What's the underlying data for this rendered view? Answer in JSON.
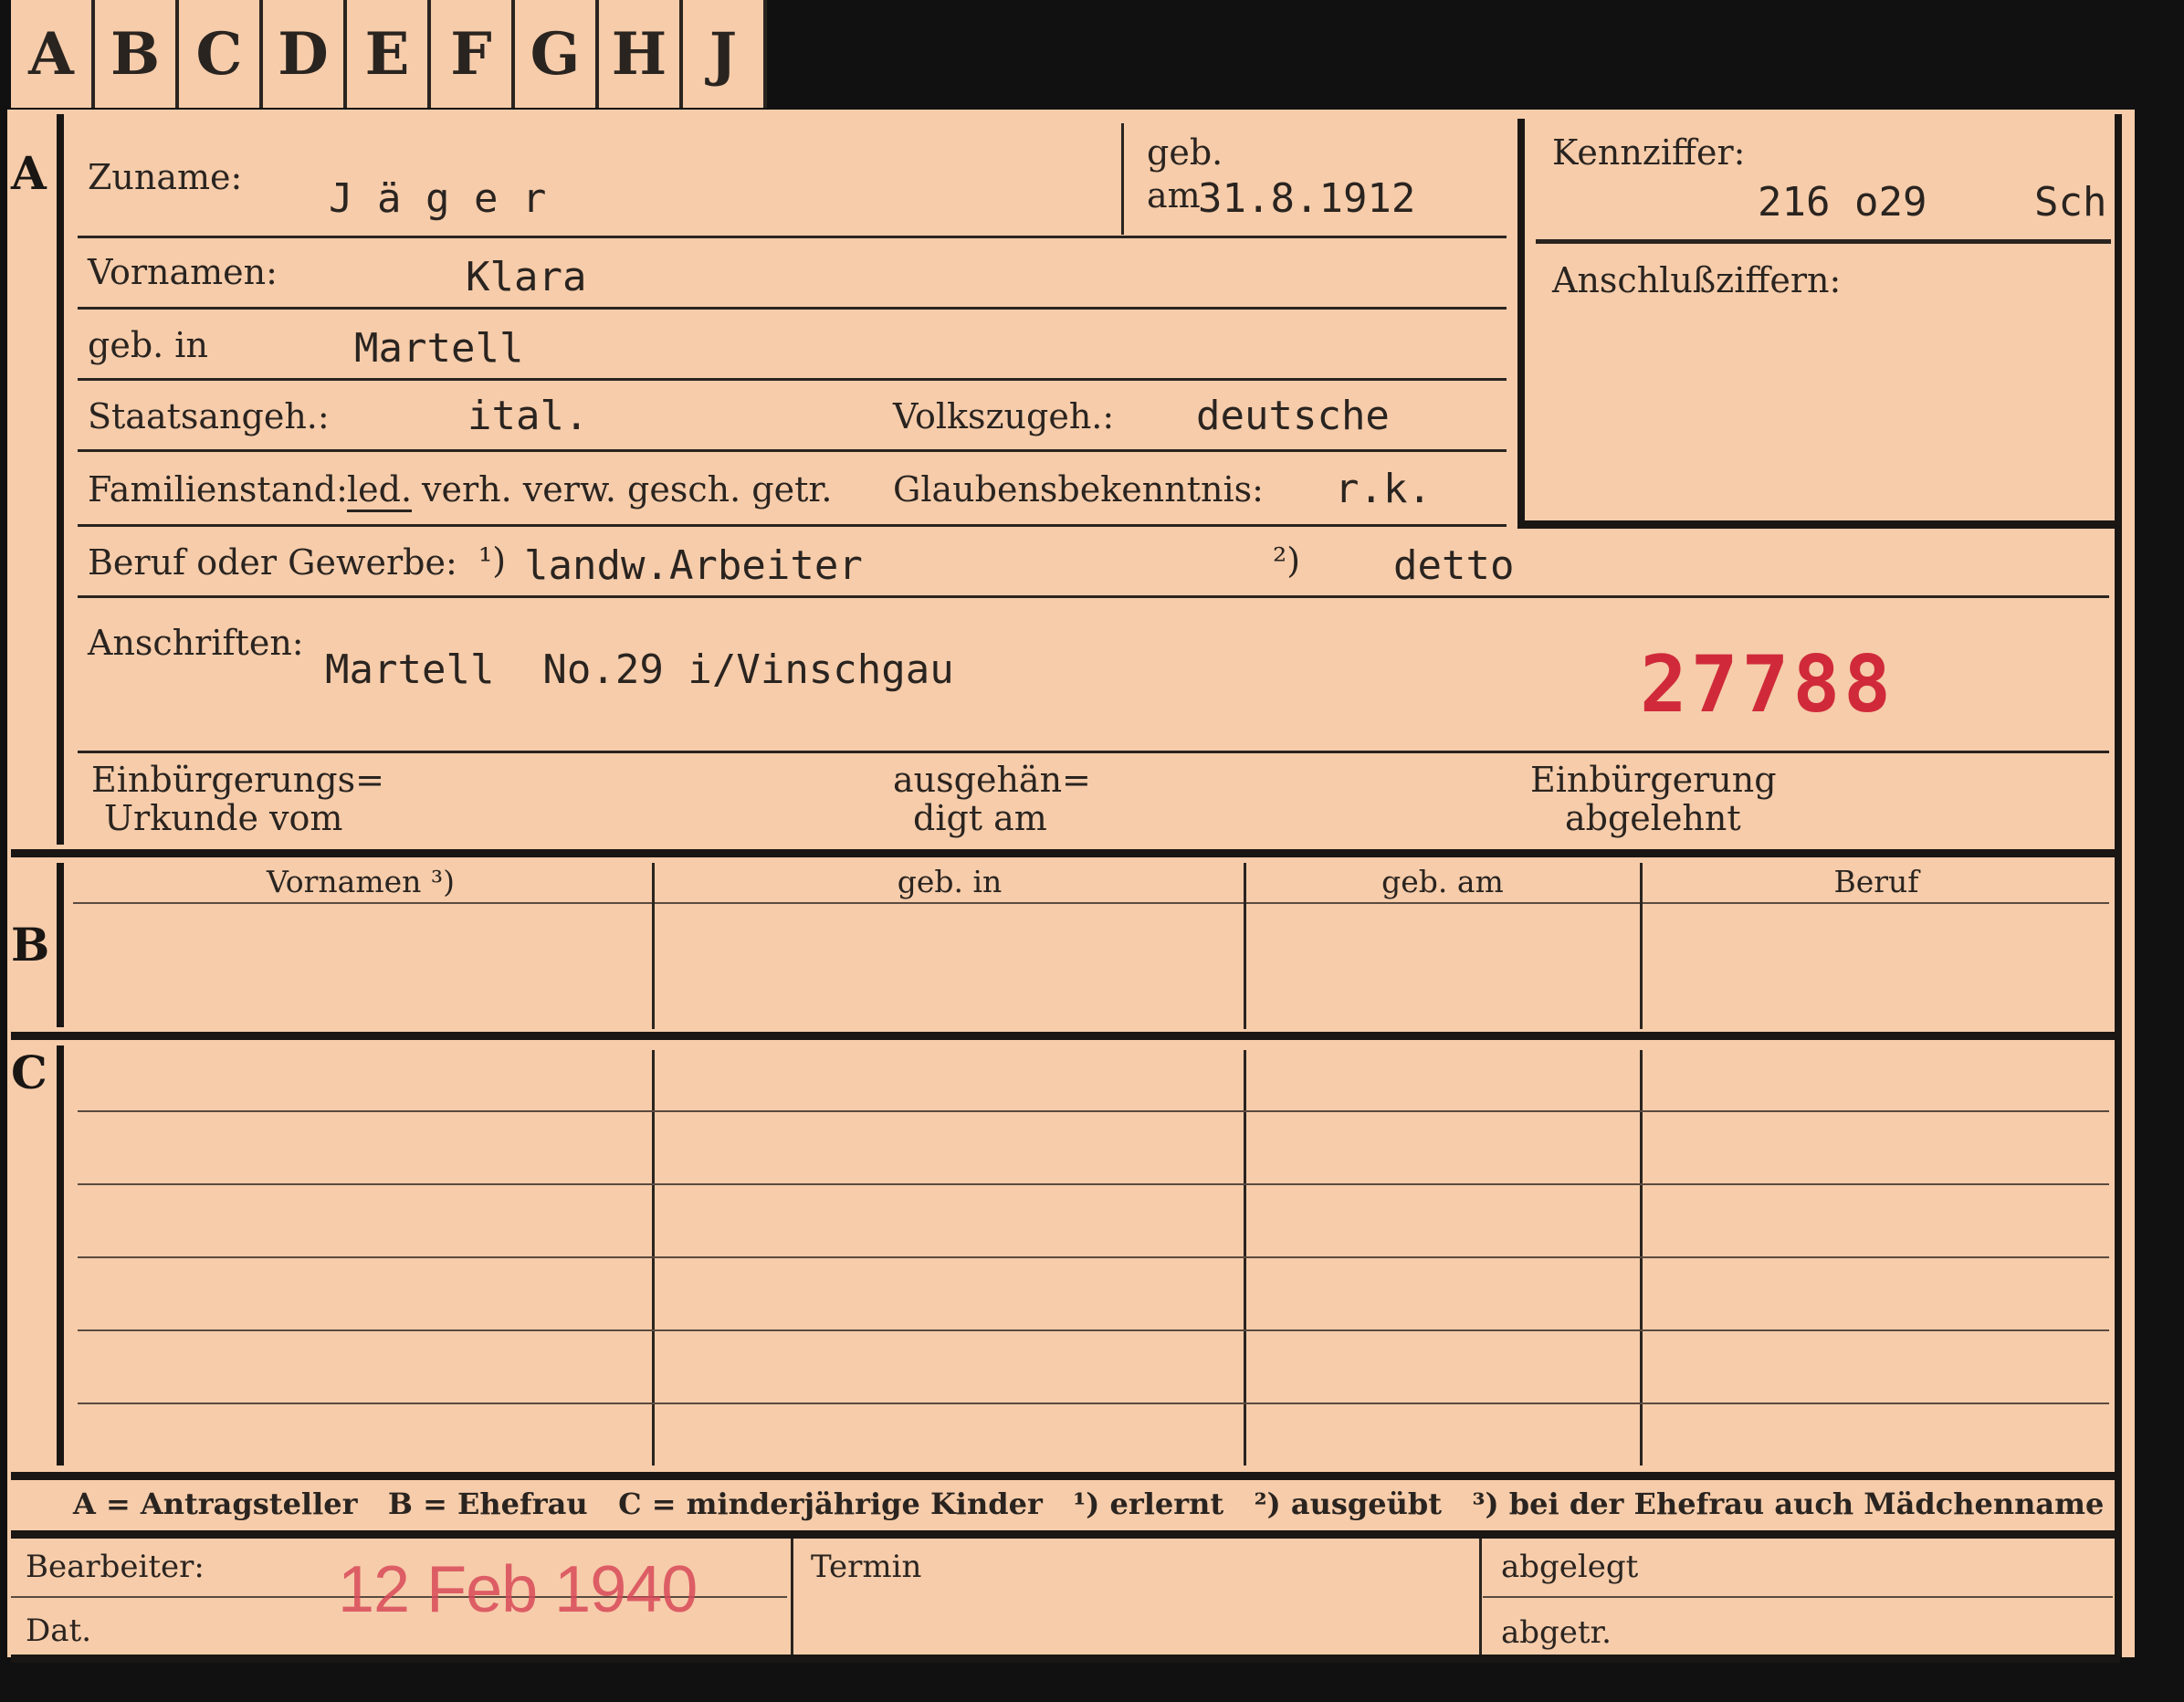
{
  "tabs": [
    "A",
    "B",
    "C",
    "D",
    "E",
    "F",
    "G",
    "H",
    "J"
  ],
  "sections": {
    "a": "A",
    "b": "B",
    "c": "C"
  },
  "fields": {
    "zuname_label": "Zuname:",
    "zuname_value": "J ä g e r",
    "geb_label": "geb.",
    "am_label": "am",
    "geb_am_value": "31.8.1912",
    "kennziffer_label": "Kennziffer:",
    "kennziffer_value": "216 o29",
    "kennziffer_suffix": "Sch",
    "anschluss_label": "Anschlußziffern:",
    "vornamen_label": "Vornamen:",
    "vornamen_value": "Klara",
    "gebin_label": "geb. in",
    "gebin_value": "Martell",
    "staat_label": "Staatsangeh.:",
    "staat_value": "ital.",
    "volks_label": "Volkszugeh.:",
    "volks_value": "deutsche",
    "famstand_label": "Familienstand:",
    "famstand_selected": "led.",
    "famstand_options": "verh. verw. gesch. getr.",
    "glaube_label": "Glaubensbekenntnis:",
    "glaube_value": "r.k.",
    "beruf_label": "Beruf oder Gewerbe:",
    "beruf_m1": "¹)",
    "beruf_value1": "landw.Arbeiter",
    "beruf_m2": "²)",
    "beruf_value2": "detto",
    "anschr_label": "Anschriften:",
    "anschr_value": "Martell  No.29 i/Vinschgau",
    "stamp_number": "27788",
    "einb_label1": "Einbürgerungs=",
    "einb_label2": "Urkunde vom",
    "ausgeh_label1": "ausgehän=",
    "ausgeh_label2": "digt am",
    "abgelehnt_label1": "Einbürgerung",
    "abgelehnt_label2": "abgelehnt"
  },
  "table_headers": [
    "Vornamen ³)",
    "geb. in",
    "geb. am",
    "Beruf"
  ],
  "legend": "A = Antragsteller   B = Ehefrau   C = minderjährige Kinder   ¹) erlernt   ²) ausgeübt   ³) bei der Ehefrau auch Mädchenname",
  "footer": {
    "bearbeiter_label": "Bearbeiter:",
    "dat_label": "Dat.",
    "date_stamp": "12 Feb 1940",
    "termin_label": "Termin",
    "abgelegt_label": "abgelegt",
    "abgetr_label": "abgetr."
  },
  "colors": {
    "card": "#f6ccaa",
    "ink": "#2a2420",
    "stamp_red": "#d02a3a",
    "background": "#111111"
  }
}
